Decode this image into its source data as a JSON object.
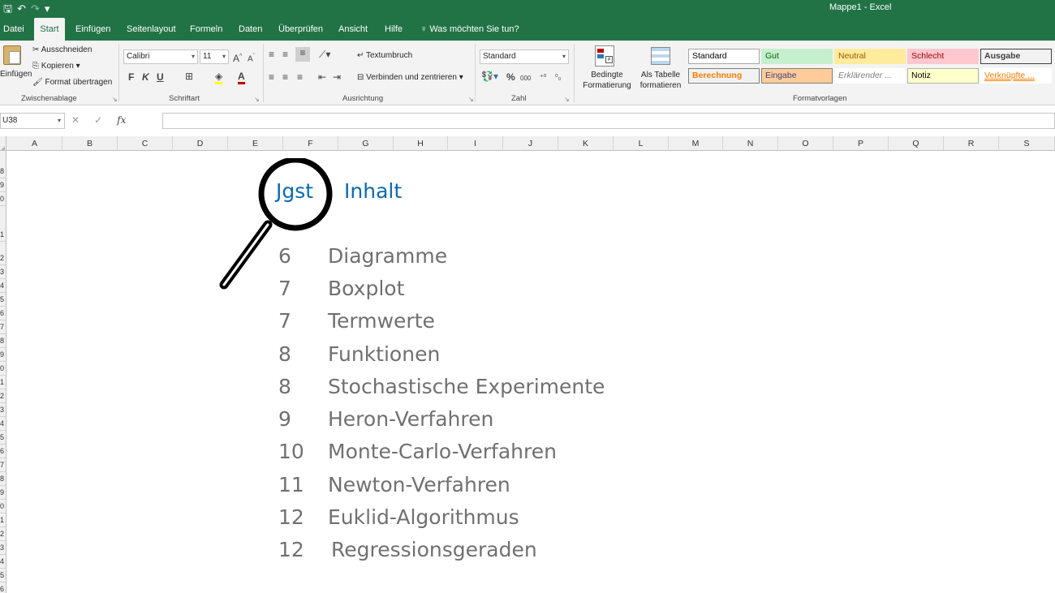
{
  "titlebar": {
    "title": "Mappe1  -  Excel",
    "save_glyph": "🖫",
    "undo_glyph": "↶",
    "redo_glyph": "↷",
    "customize_glyph": "▾"
  },
  "tabs": [
    "Datei",
    "Start",
    "Einfügen",
    "Seitenlayout",
    "Formeln",
    "Daten",
    "Überprüfen",
    "Ansicht",
    "Hilfe"
  ],
  "tell_me": "Was möchten Sie tun?",
  "ribbon": {
    "clipboard": {
      "paste": "Einfügen",
      "cut": "Ausschneiden",
      "copy": "Kopieren",
      "format_painter": "Format übertragen",
      "label": "Zwischenablage"
    },
    "font": {
      "name": "Calibri",
      "size": "11",
      "bold": "F",
      "italic": "K",
      "underline": "U",
      "label": "Schriftart"
    },
    "alignment": {
      "wrap": "Textumbruch",
      "merge": "Verbinden und zentrieren",
      "label": "Ausrichtung"
    },
    "number": {
      "format": "Standard",
      "percent": "%",
      "thousands": "000",
      "label": "Zahl"
    },
    "conditional": "Bedingte Formatierung",
    "as_table": "Als Tabelle formatieren",
    "styles": {
      "label": "Formatvorlagen",
      "cells": [
        {
          "name": "Standard",
          "bg": "#ffffff",
          "fg": "#000000",
          "border": "#a6a6a6"
        },
        {
          "name": "Gut",
          "bg": "#c6efce",
          "fg": "#006100",
          "border": "#c6efce"
        },
        {
          "name": "Neutral",
          "bg": "#ffeb9c",
          "fg": "#9c5700",
          "border": "#ffeb9c"
        },
        {
          "name": "Schlecht",
          "bg": "#ffc7ce",
          "fg": "#9c0006",
          "border": "#ffc7ce"
        },
        {
          "name": "Ausgabe",
          "bg": "#f2f2f2",
          "fg": "#3f3f3f",
          "border": "#3f3f3f"
        },
        {
          "name": "Berechnung",
          "bg": "#f2f2f2",
          "fg": "#fa7d00",
          "border": "#7f7f7f"
        },
        {
          "name": "Eingabe",
          "bg": "#ffcc99",
          "fg": "#3f3f76",
          "border": "#7f7f7f"
        },
        {
          "name": "Erklärender ...",
          "bg": "#ffffff",
          "fg": "#7f7f7f",
          "border": "#ffffff"
        },
        {
          "name": "Notiz",
          "bg": "#ffffcc",
          "fg": "#000000",
          "border": "#b2b2b2"
        },
        {
          "name": "Verknüpfte ...",
          "bg": "#ffffff",
          "fg": "#fa7d00",
          "border": "#ffffff"
        }
      ]
    }
  },
  "formula_bar": {
    "name_box": "U38",
    "fx": "fx",
    "cancel": "✕",
    "enter": "✓",
    "value": ""
  },
  "columns": [
    "A",
    "B",
    "C",
    "D",
    "E",
    "F",
    "G",
    "H",
    "I",
    "J",
    "K",
    "L",
    "M",
    "N",
    "O",
    "P",
    "Q",
    "R",
    "S"
  ],
  "rows": [
    "8",
    "9",
    "0",
    "1",
    "2",
    "3",
    "4",
    "5",
    "6",
    "7",
    "8",
    "9",
    "0",
    "1",
    "2",
    "3",
    "4",
    "5",
    "6",
    "7",
    "8",
    "9",
    "0",
    "1",
    "2",
    "3",
    "4",
    "5",
    "6"
  ],
  "sheet": {
    "header_jgst": "Jgst",
    "header_inhalt": "Inhalt",
    "entries": [
      {
        "jgst": "6",
        "topic": "Diagramme"
      },
      {
        "jgst": "7",
        "topic": "Boxplot"
      },
      {
        "jgst": "7",
        "topic": "Termwerte"
      },
      {
        "jgst": "8",
        "topic": "Funktionen"
      },
      {
        "jgst": "8",
        "topic": "Stochastische Experimente"
      },
      {
        "jgst": "9",
        "topic": "Heron-Verfahren"
      },
      {
        "jgst": "10",
        "topic": "Monte-Carlo-Verfahren"
      },
      {
        "jgst": "11",
        "topic": "Newton-Verfahren"
      },
      {
        "jgst": "12",
        "topic": "Euklid-Algorithmus"
      },
      {
        "jgst": "12",
        "topic": "Regressionsgeraden"
      }
    ]
  },
  "colors": {
    "excel_green": "#217346",
    "heading_blue": "#0a6ab3",
    "text_gray": "#707070"
  }
}
